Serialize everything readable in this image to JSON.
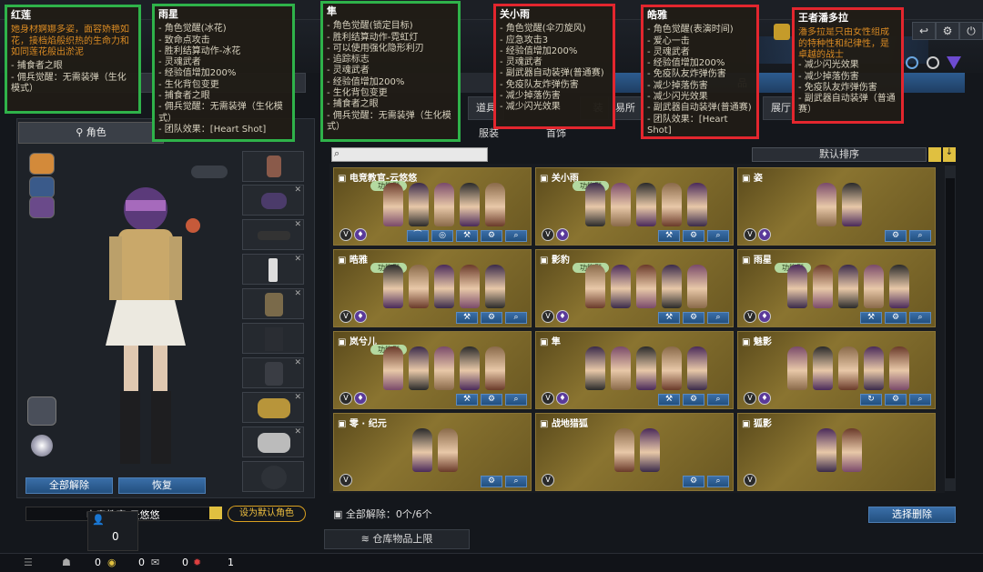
{
  "tooltips": {
    "honglian": {
      "title": "红莲",
      "desc": "她身材婀娜多姿，面容娇艳如花，接档焰般织热的生命力和如同莲花般出淤泥",
      "items": [
        "捕食者之眼",
        "佣兵觉醒：无需装弹（生化模式）"
      ]
    },
    "yuxing": {
      "title": "雨星",
      "items": [
        "角色觉醒(冰花)",
        "致命点攻击",
        "胜利结算动作-冰花",
        "灵魂武者",
        "经验值增加200%",
        "生化背包变更",
        "捕食者之眼",
        "佣兵觉醒：无需装弹（生化模式）",
        "团队效果：[Heart Shot]"
      ]
    },
    "sun": {
      "title": "隼",
      "items": [
        "角色觉醒(锁定目标)",
        "胜利结算动作-霓虹灯",
        "可以使用强化隐形利刃",
        "追踪标志",
        "灵魂武者",
        "经验值增加200%",
        "生化背包变更",
        "捕食者之眼",
        "佣兵觉醒：无需装弹（生化模式）"
      ]
    },
    "guanxiaoyu": {
      "title": "关小雨",
      "items": [
        "角色觉醒(伞刃旋风)",
        "应急攻击3",
        "经验值增加200%",
        "灵魂武者",
        "副武器自动装弹(普通赛)",
        "免疫队友炸弹伤害",
        "减少掉落伤害",
        "减少闪光效果"
      ]
    },
    "qiaoya": {
      "title": "皓雅",
      "items": [
        "角色觉醒(表演时间)",
        "爱心一击",
        "灵魂武者",
        "经验值增加200%",
        "免疫队友炸弹伤害",
        "减少掉落伤害",
        "减少闪光效果",
        "副武器自动装弹(普通赛)",
        "团队效果：[Heart Shot]"
      ]
    },
    "pandora": {
      "title": "王者潘多拉",
      "desc": "潘多拉是只由女性组成的特种性和纪律性，是卓越的战士",
      "items": [
        "减少闪光效果",
        "减少掉落伤害",
        "免疫队友炸弹伤害",
        "副武器自动装弹（普通赛）"
      ]
    }
  },
  "tabs": {
    "sub": [
      "道具",
      "装",
      "易所",
      "展厅"
    ],
    "cat": [
      "服装",
      "首饰"
    ],
    "role_tab": "角色",
    "partial_label": "品"
  },
  "sort_label": "默认排序",
  "left": {
    "unequip_all": "全部解除",
    "restore": "恢复",
    "set_default": "设为默认角色",
    "name_partial": "电竞教官-云悠悠",
    "count": "0"
  },
  "cards": [
    {
      "name": "电竞教官-云悠悠",
      "badge": "功能型",
      "actions": [
        "hanger",
        "compass",
        "settings",
        "gear",
        "search"
      ]
    },
    {
      "name": "关小雨",
      "badge": "功能型",
      "actions": [
        "wrench",
        "gear",
        "search"
      ]
    },
    {
      "name": "姿",
      "badge": "",
      "actions": [
        "gear",
        "search"
      ]
    },
    {
      "name": "晧雅",
      "badge": "功能型",
      "actions": [
        "wrench",
        "gear",
        "search"
      ]
    },
    {
      "name": "影豹",
      "badge": "功能型",
      "actions": [
        "wrench",
        "gear",
        "search"
      ]
    },
    {
      "name": "雨星",
      "badge": "功能型",
      "actions": [
        "wrench",
        "gear",
        "search"
      ]
    },
    {
      "name": "岚兮儿",
      "badge": "功能型",
      "actions": [
        "wrench",
        "gear",
        "search"
      ]
    },
    {
      "name": "隼",
      "badge": "",
      "actions": [
        "wrench",
        "gear",
        "search"
      ]
    },
    {
      "name": "魅影",
      "badge": "",
      "actions": [
        "refresh",
        "gear",
        "search"
      ]
    },
    {
      "name": "零 · 纪元",
      "badge": "",
      "actions": [
        "gear",
        "search"
      ]
    },
    {
      "name": "战地猎狐",
      "badge": "",
      "actions": [
        "gear",
        "search"
      ]
    },
    {
      "name": "狐影",
      "badge": "",
      "actions": []
    }
  ],
  "bottom": {
    "unequip_count": "全部解除：0个/6个",
    "select_delete": "选择删除",
    "warehouse_limit": "仓库物品上限"
  },
  "statusbar": {
    "v1": "0",
    "v2": "0",
    "v3": "0",
    "v4": "1"
  },
  "colors": {
    "green_border": "#2fb24a",
    "red_border": "#e3262e",
    "card_gold": "#8a7430",
    "blue_button": "#2d5c8f"
  }
}
